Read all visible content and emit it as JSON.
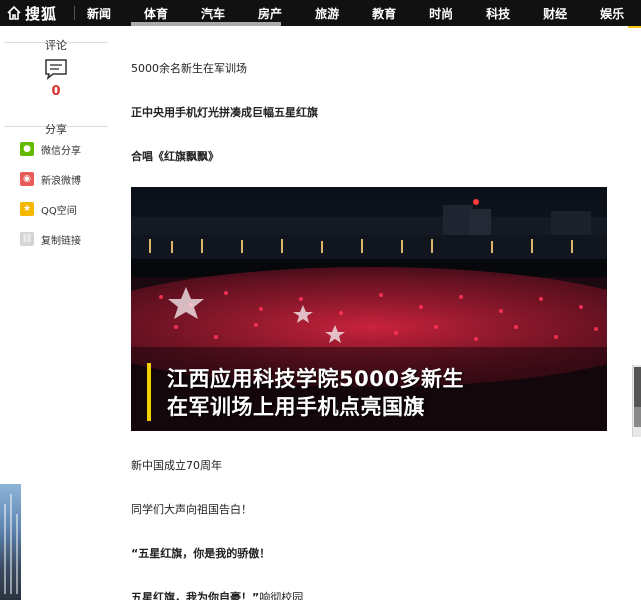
{
  "nav": {
    "logo": "搜狐",
    "items": [
      "新闻",
      "体育",
      "汽车",
      "房产",
      "旅游",
      "教育",
      "时尚",
      "科技",
      "财经",
      "娱乐"
    ]
  },
  "sidebar": {
    "comment_label": "评论",
    "comment_count": "0",
    "share_label": "分享",
    "share_items": [
      {
        "label": "微信分享",
        "icon": "wechat-icon",
        "color": "#62b900"
      },
      {
        "label": "新浪微博",
        "icon": "weibo-icon",
        "color": "#e85b5b"
      },
      {
        "label": "QQ空间",
        "icon": "qzone-icon",
        "color": "#f5b800"
      },
      {
        "label": "复制链接",
        "icon": "link-icon",
        "color": "#bdbdbd"
      }
    ]
  },
  "article": {
    "paragraphs": [
      {
        "text": "5000余名新生在军训场",
        "bold": false
      },
      {
        "text": "正中央用手机灯光拼凑成巨幅五星红旗",
        "bold": true
      },
      {
        "text": "合唱《红旗飘飘》",
        "bold": true
      },
      {
        "text": "新中国成立70周年",
        "bold": false
      },
      {
        "text": "同学们大声向祖国告白！",
        "bold": false
      },
      {
        "text": "“五星红旗，你是我的骄傲！",
        "bold": true
      }
    ],
    "last_line_bold": "五星红旗，我为你自豪！”",
    "last_line_normal": "响彻校园",
    "video_caption_line1": "江西应用科技学院5000多新生",
    "video_caption_line2": "在军训场上用手机点亮国旗"
  },
  "colors": {
    "nav_bg": "#111111",
    "accent_yellow": "#f5c518",
    "comment_count": "#e03030"
  }
}
